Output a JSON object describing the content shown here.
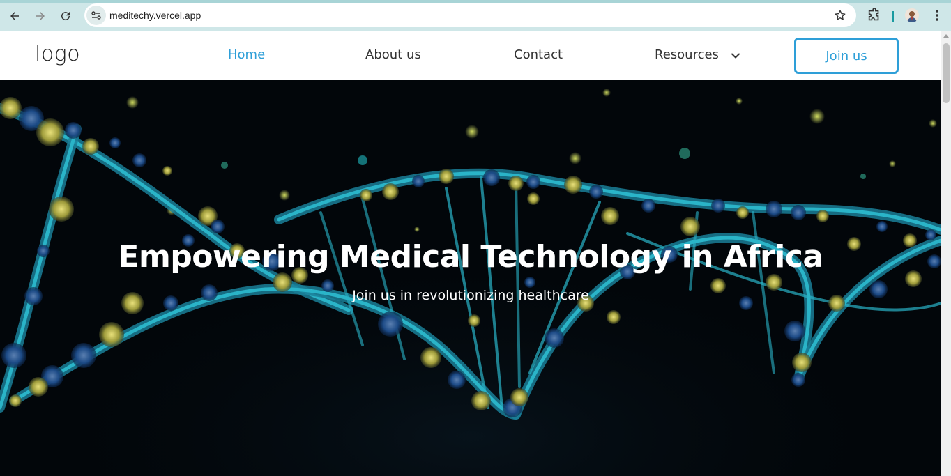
{
  "browser": {
    "url": "meditechy.vercel.app",
    "accent": "#1a9aa0"
  },
  "header": {
    "logo": "logo",
    "nav": [
      {
        "label": "Home",
        "active": true
      },
      {
        "label": "About us"
      },
      {
        "label": "Contact"
      },
      {
        "label": "Resources"
      }
    ],
    "join_label": "Join us",
    "accent": "#2e9fd8"
  },
  "hero": {
    "title": "Empowering Medical Technology in Africa",
    "subtitle": "Join us in revolutionizing healthcare"
  },
  "icons": [
    "back-icon",
    "forward-icon",
    "reload-icon",
    "site-info-icon",
    "star-icon",
    "extensions-icon",
    "avatar",
    "menu-icon",
    "chevron-down-icon"
  ]
}
